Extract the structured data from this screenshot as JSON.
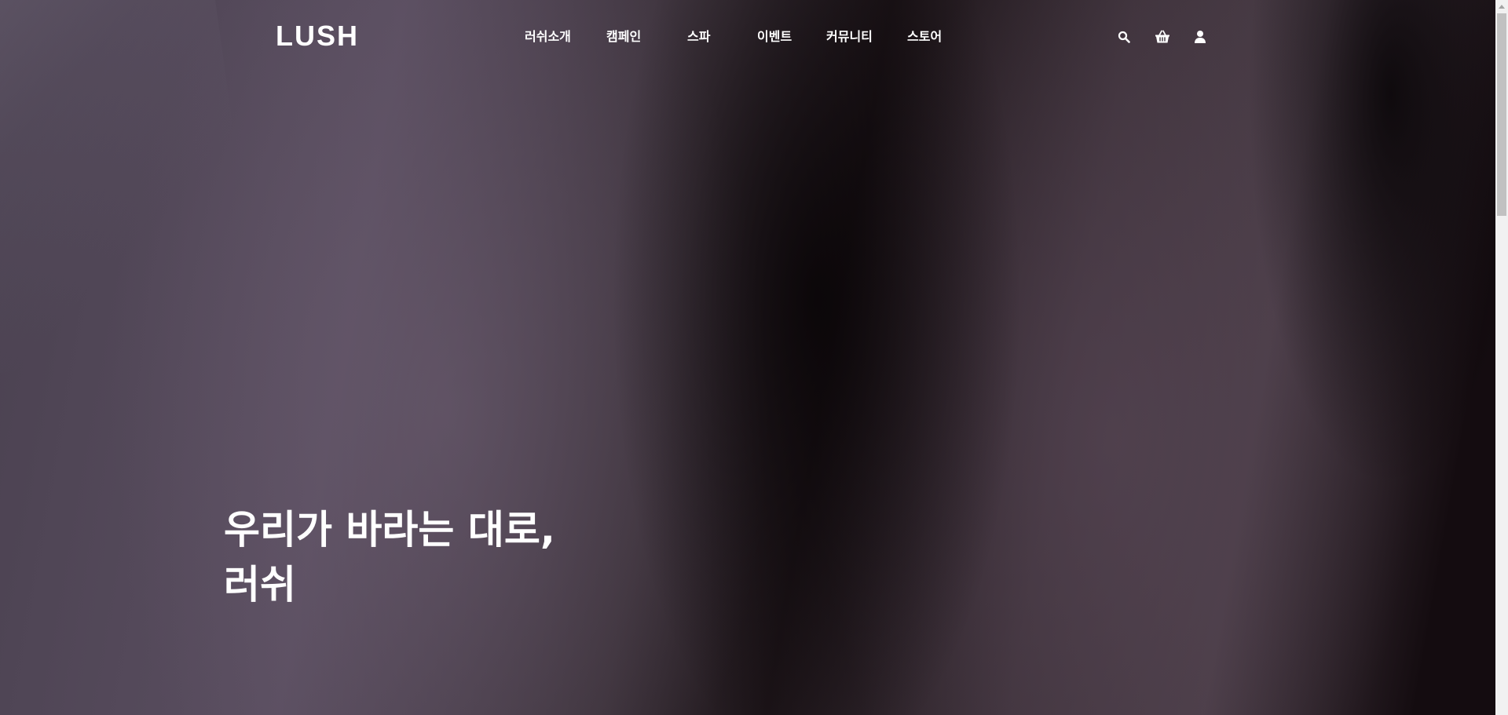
{
  "brand": {
    "logo_text": "LUSH"
  },
  "nav": {
    "items": [
      {
        "label": "러쉬소개"
      },
      {
        "label": "캠페인"
      },
      {
        "label": "스파"
      },
      {
        "label": "이벤트"
      },
      {
        "label": "커뮤니티"
      },
      {
        "label": "스토어"
      }
    ]
  },
  "header_icons": [
    {
      "icon": "search-icon"
    },
    {
      "icon": "shopping-basket-icon"
    },
    {
      "icon": "user-icon"
    }
  ],
  "hero": {
    "title_line1": "우리가 바라는 대로,",
    "title_line2": "러쉬"
  },
  "colors": {
    "text": "#ffffff",
    "background": "#1a1418"
  }
}
